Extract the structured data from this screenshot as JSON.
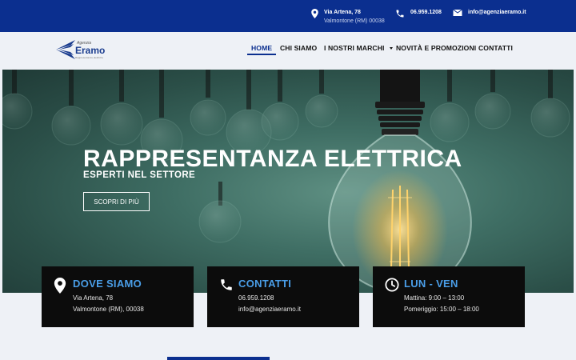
{
  "topbar": {
    "address_line1": "Via Artena, 78",
    "address_line2": "Valmontone (RM) 00038",
    "phone": "06.959.1208",
    "email": "info@agenziaeramo.it"
  },
  "logo": {
    "line1": "Agenzia",
    "line2": "Eramo",
    "line3": "Rappresentanze elettriche"
  },
  "nav": {
    "items": [
      {
        "label": "HOME"
      },
      {
        "label": "CHI SIAMO"
      },
      {
        "label": "I NOSTRI MARCHI"
      },
      {
        "label": "NOVITÀ E PROMOZIONI"
      },
      {
        "label": "CONTATTI"
      }
    ]
  },
  "hero": {
    "title": "RAPPRESENTANZA ELETTRICA",
    "subtitle": "ESPERTI NEL SETTORE",
    "button": "SCOPRI DI PIÙ"
  },
  "cards": [
    {
      "title": "DOVE SIAMO",
      "line1": "Via Artena, 78",
      "line2": "Valmontone (RM), 00038"
    },
    {
      "title": "CONTATTI",
      "line1": "06.959.1208",
      "line2": "info@agenziaeramo.it"
    },
    {
      "title": "LUN - VEN",
      "line1": "Mattina: 9:00 – 13:00",
      "line2": "Pomeriggio: 15:00 – 18:00"
    }
  ],
  "colors": {
    "brand_blue": "#0b2f8f",
    "accent_blue": "#4a9ee8",
    "card_bg": "#0c0c0c"
  }
}
